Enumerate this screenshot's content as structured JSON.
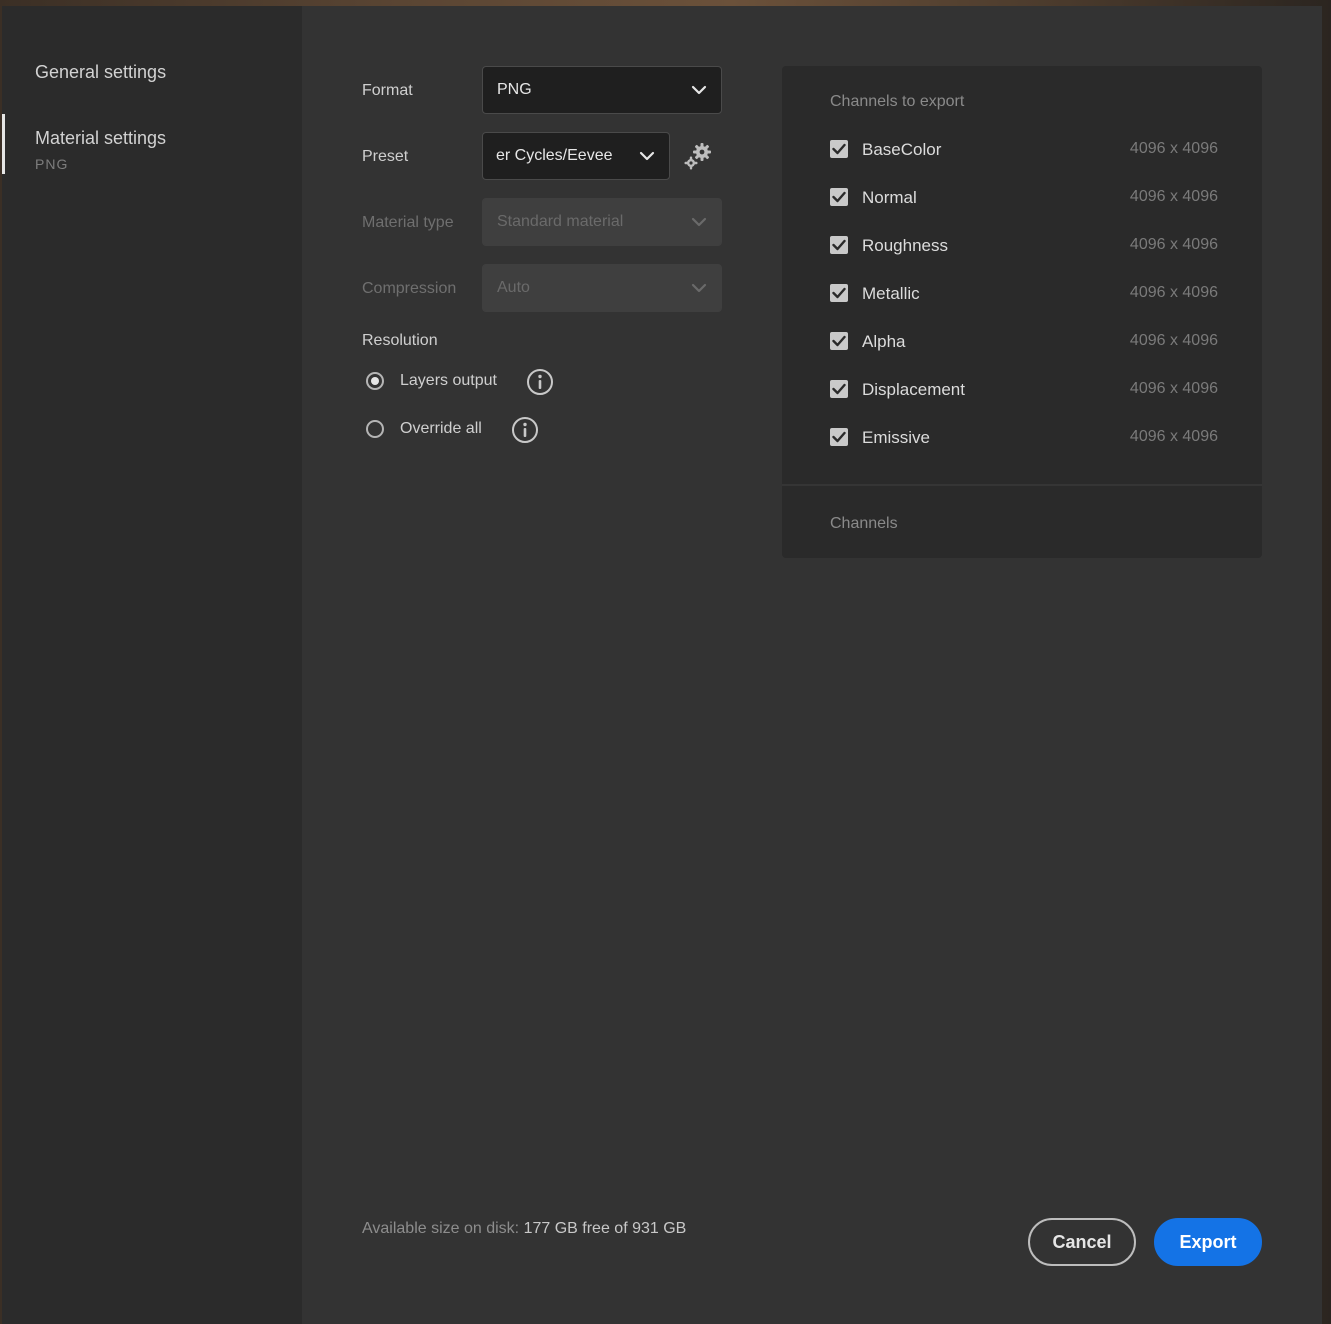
{
  "sidebar": {
    "items": [
      {
        "label": "General settings"
      },
      {
        "label": "Material settings",
        "sub": "PNG"
      }
    ]
  },
  "form": {
    "format": {
      "label": "Format",
      "value": "PNG"
    },
    "preset": {
      "label": "Preset",
      "value": "er Cycles/Eevee"
    },
    "material_type": {
      "label": "Material type",
      "value": "Standard material"
    },
    "compression": {
      "label": "Compression",
      "value": "Auto"
    },
    "resolution": {
      "label": "Resolution",
      "options": [
        {
          "label": "Layers output",
          "selected": true
        },
        {
          "label": "Override all",
          "selected": false
        }
      ]
    }
  },
  "channels": {
    "title": "Channels to export",
    "items": [
      {
        "name": "BaseColor",
        "res": "4096 x 4096",
        "checked": true
      },
      {
        "name": "Normal",
        "res": "4096 x 4096",
        "checked": true
      },
      {
        "name": "Roughness",
        "res": "4096 x 4096",
        "checked": true
      },
      {
        "name": "Metallic",
        "res": "4096 x 4096",
        "checked": true
      },
      {
        "name": "Alpha",
        "res": "4096 x 4096",
        "checked": true
      },
      {
        "name": "Displacement",
        "res": "4096 x 4096",
        "checked": true
      },
      {
        "name": "Emissive",
        "res": "4096 x 4096",
        "checked": true
      }
    ],
    "footer": "Channels"
  },
  "footer": {
    "disk_label": "Available size on disk:",
    "disk_value": "177 GB free of 931 GB",
    "cancel": "Cancel",
    "export": "Export"
  },
  "colors": {
    "accent": "#1473e6",
    "dialog_bg": "#333333",
    "sidebar_bg": "#2b2b2b"
  }
}
